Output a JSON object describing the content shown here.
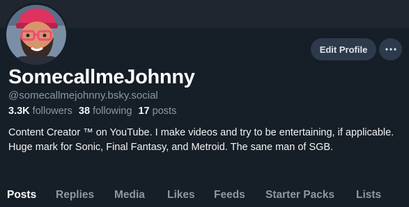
{
  "profile": {
    "display_name": "SomecallmeJohnny",
    "handle": "@somecallmejohnny.bsky.social",
    "bio": "Content Creator ™ on YouTube. I make videos and try to be entertaining, if applicable. Huge mark for Sonic, Final Fantasy, and Metroid. The sane man of SGB.",
    "stats": {
      "followers_count": "3.3K",
      "followers_label": "followers",
      "following_count": "38",
      "following_label": "following",
      "posts_count": "17",
      "posts_label": "posts"
    }
  },
  "actions": {
    "edit_label": "Edit Profile",
    "more_icon": "ellipsis-icon"
  },
  "tabs": [
    {
      "label": "Posts",
      "active": true
    },
    {
      "label": "Replies",
      "active": false
    },
    {
      "label": "Media",
      "active": false
    },
    {
      "label": "Likes",
      "active": false
    },
    {
      "label": "Feeds",
      "active": false
    },
    {
      "label": "Starter Packs",
      "active": false
    },
    {
      "label": "Lists",
      "active": false
    }
  ],
  "colors": {
    "background": "#161e27",
    "banner": "#1f2630",
    "button": "#2c3a4b",
    "muted_text": "#8b98a5",
    "text": "#f1f3f5"
  }
}
